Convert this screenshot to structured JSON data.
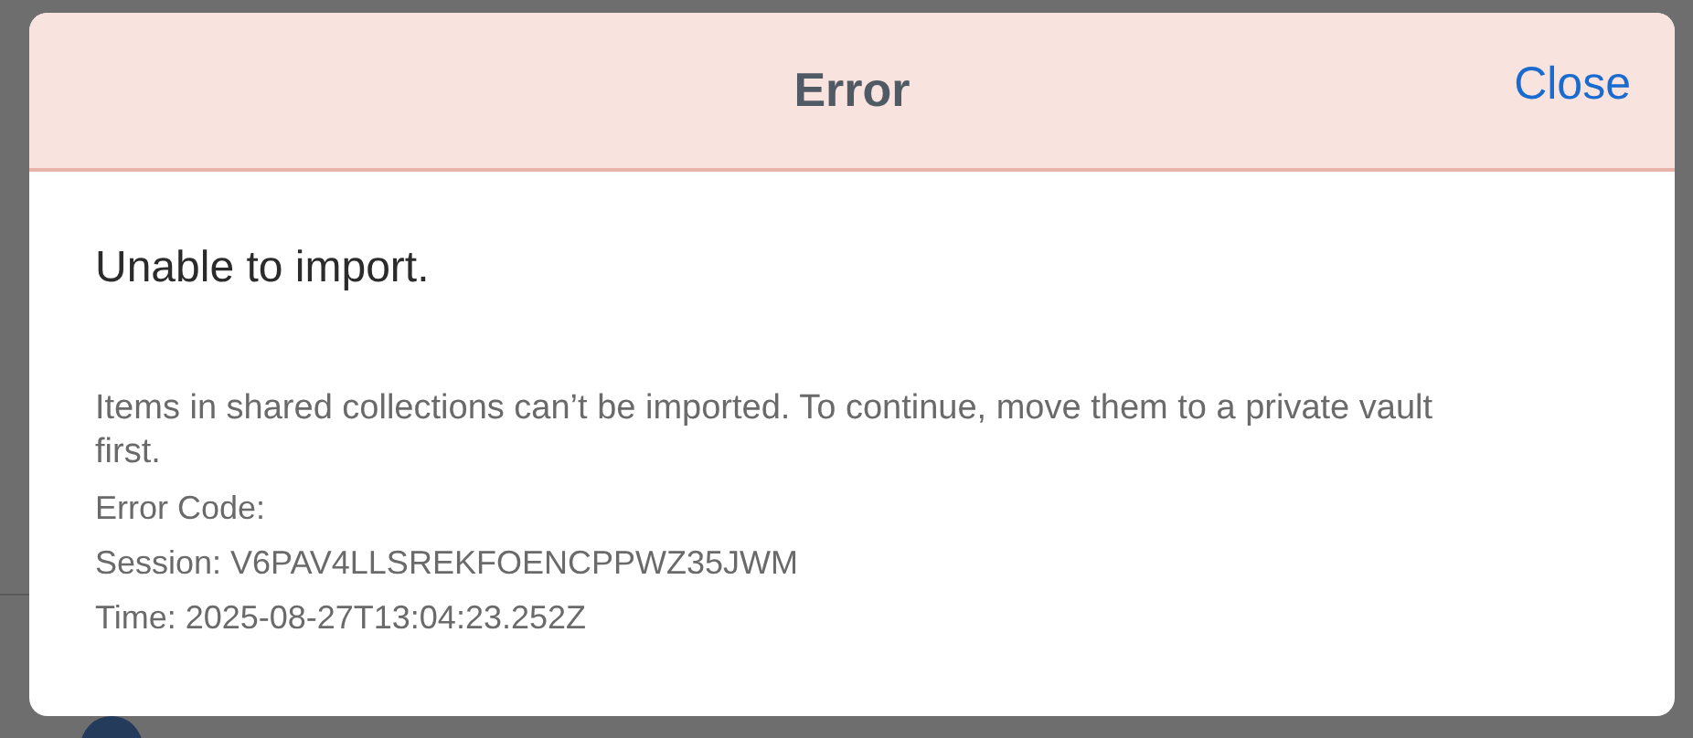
{
  "dialog": {
    "title": "Error",
    "close_button": "Close",
    "heading": "Unable to import.",
    "message": "Items in shared collections can’t be imported. To continue, move them to a private vault first.",
    "details": [
      "Error Code:",
      "Session: V6PAV4LLSREKFOENCPPWZ35JWM",
      "Time: 2025-08-27T13:04:23.252Z"
    ]
  }
}
